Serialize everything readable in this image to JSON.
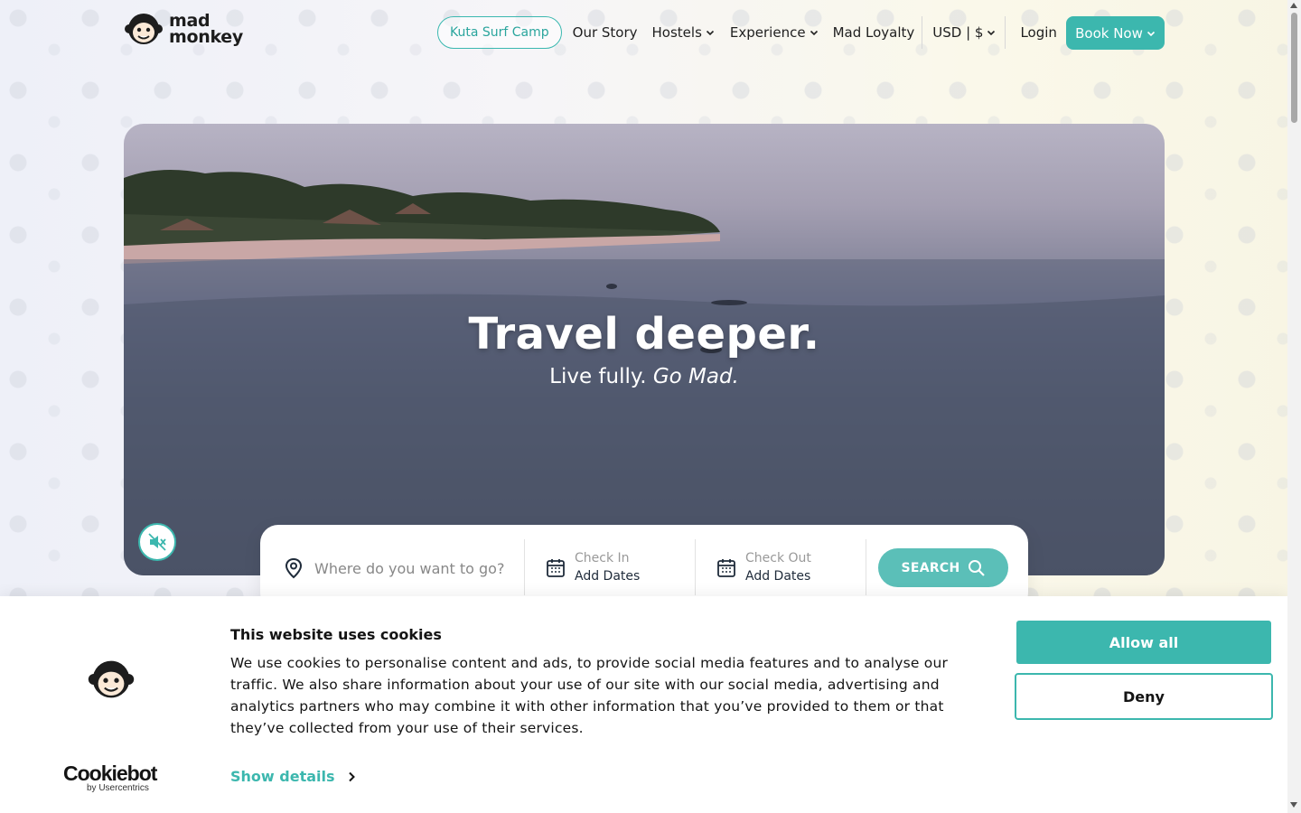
{
  "brand": {
    "line1": "mad",
    "line2": "monkey"
  },
  "nav": {
    "promo": "Kuta Surf Camp",
    "our_story": "Our Story",
    "hostels": "Hostels",
    "experience": "Experience",
    "loyalty": "Mad Loyalty",
    "currency": "USD | $",
    "login": "Login",
    "book_now": "Book Now"
  },
  "hero": {
    "title": "Travel deeper.",
    "subtitle_plain": "Live fully.",
    "subtitle_italic": "Go Mad."
  },
  "search": {
    "where_placeholder": "Where do you want to go?",
    "check_in_label": "Check In",
    "check_in_value": "Add Dates",
    "check_out_label": "Check Out",
    "check_out_value": "Add Dates",
    "button": "SEARCH"
  },
  "cookie": {
    "title": "This website uses cookies",
    "text": "We use cookies to personalise content and ads, to provide social media features and to analyse our traffic. We also share information about your use of our site with our social media, advertising and analytics partners who may combine it with other information that you’ve provided to them or that they’ve collected from your use of their services.",
    "show_details": "Show details",
    "allow_all": "Allow all",
    "deny": "Deny",
    "provider_main": "Cookiebot",
    "provider_sub": "by Usercentrics"
  },
  "colors": {
    "accent": "#3cb7ae",
    "text": "#141414"
  },
  "icons": [
    "monkey-logo-icon",
    "chevron-down-icon",
    "mute-icon",
    "location-pin-icon",
    "calendar-icon",
    "search-icon",
    "chevron-right-icon"
  ]
}
